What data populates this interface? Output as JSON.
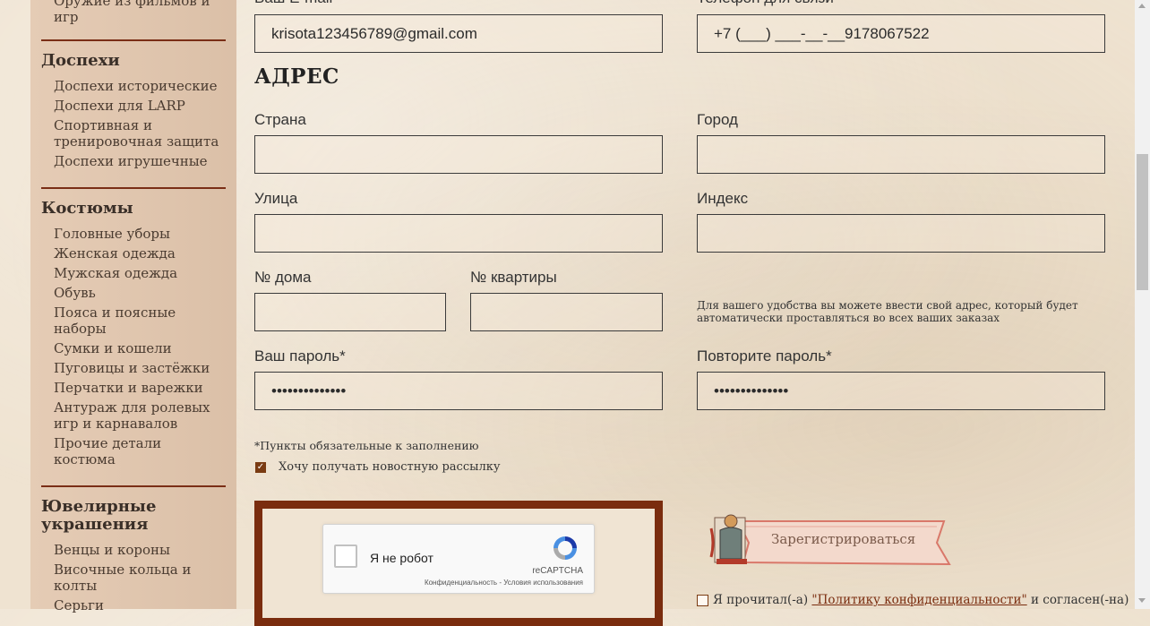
{
  "sidebar": {
    "top_partial": [
      "Оружие из фильмов и",
      "игр"
    ],
    "sections": [
      {
        "title": "Доспехи",
        "items": [
          "Доспехи исторические",
          "Доспехи для LARP",
          "Спортивная и тренировочная защита",
          "Доспехи игрушечные"
        ]
      },
      {
        "title": "Костюмы",
        "items": [
          "Головные уборы",
          "Женская одежда",
          "Мужская одежда",
          "Обувь",
          "Пояса и поясные наборы",
          "Сумки и кошели",
          "Пуговицы и застёжки",
          "Перчатки и варежки",
          "Антураж для ролевых игр и карнавалов",
          "Прочие детали костюма"
        ]
      },
      {
        "title": "Ювелирные украшения",
        "items": [
          "Венцы и короны",
          "Височные кольца и колты",
          "Серьги"
        ]
      }
    ]
  },
  "form": {
    "email_label": "Ваш E-mail",
    "email_value": "krisota123456789@gmail.com",
    "phone_label": "Телефон для связи",
    "phone_value": "+7 (___) ___-__-__9178067522",
    "address_title": "АДРЕС",
    "country_label": "Страна",
    "country_value": "",
    "city_label": "Город",
    "city_value": "",
    "street_label": "Улица",
    "street_value": "",
    "index_label": "Индекс",
    "index_value": "",
    "house_label": "№ дома",
    "house_value": "",
    "apartment_label": "№ квартиры",
    "apartment_value": "",
    "address_note": "Для вашего удобства вы можете ввести свой адрес, который будет автоматически проставляться во всех ваших заказах",
    "password_label": "Ваш пароль*",
    "password_value": "••••••••••••••",
    "password_repeat_label": "Повторите пароль*",
    "password_repeat_value": "••••••••••••••",
    "required_note": "*Пункты обязательные к заполнению",
    "newsletter_label": "Хочу получать новостную рассылку",
    "newsletter_checked": true
  },
  "captcha": {
    "label": "Я не робот",
    "brand": "reCAPTCHA",
    "privacy": "Конфиденциальность",
    "separator": " - ",
    "terms": "Условия использования"
  },
  "register": {
    "label": "Зарегистрироваться"
  },
  "policy": {
    "prefix": "Я прочитал(-а)",
    "link": "\"Политику конфиденциальности\"",
    "suffix": "и согласен(-на)"
  },
  "colors": {
    "accent": "#7a2c0e",
    "sidebar_bg": "#e2c6ad",
    "page_bg": "#efe3d1"
  }
}
